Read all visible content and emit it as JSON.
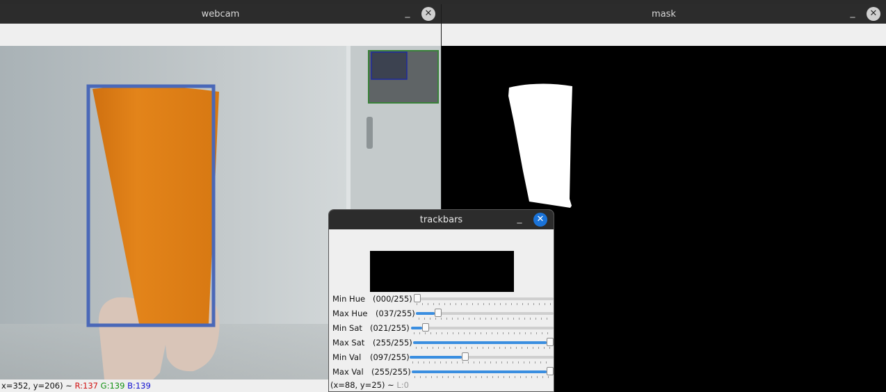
{
  "webcam": {
    "title": "webcam",
    "status": {
      "coords": "x=352, y=206) ~ ",
      "r": "R:137",
      "g": "G:139",
      "b": "B:139"
    }
  },
  "mask": {
    "title": "mask"
  },
  "trackbars": {
    "title": "trackbars",
    "sliders": [
      {
        "label": "Min Hue",
        "value_text": "(000/255)",
        "fraction": 0.0
      },
      {
        "label": "Max Hue",
        "value_text": "(037/255)",
        "fraction": 0.145
      },
      {
        "label": "Min Sat",
        "value_text": "(021/255)",
        "fraction": 0.082
      },
      {
        "label": "Max Sat",
        "value_text": "(255/255)",
        "fraction": 1.0
      },
      {
        "label": "Min Val",
        "value_text": "(097/255)",
        "fraction": 0.38
      },
      {
        "label": "Max Val",
        "value_text": "(255/255)",
        "fraction": 1.0
      }
    ],
    "status": {
      "coords": "(x=88, y=25) ~ ",
      "l": "L:0"
    }
  },
  "window_controls": {
    "minimize": "_",
    "close": "✕"
  },
  "colors": {
    "bbox_blue": "#4a68b8",
    "cup_orange": "#e2800f",
    "roi_green": "#2a7a2a",
    "accent": "#3a8ee0"
  }
}
